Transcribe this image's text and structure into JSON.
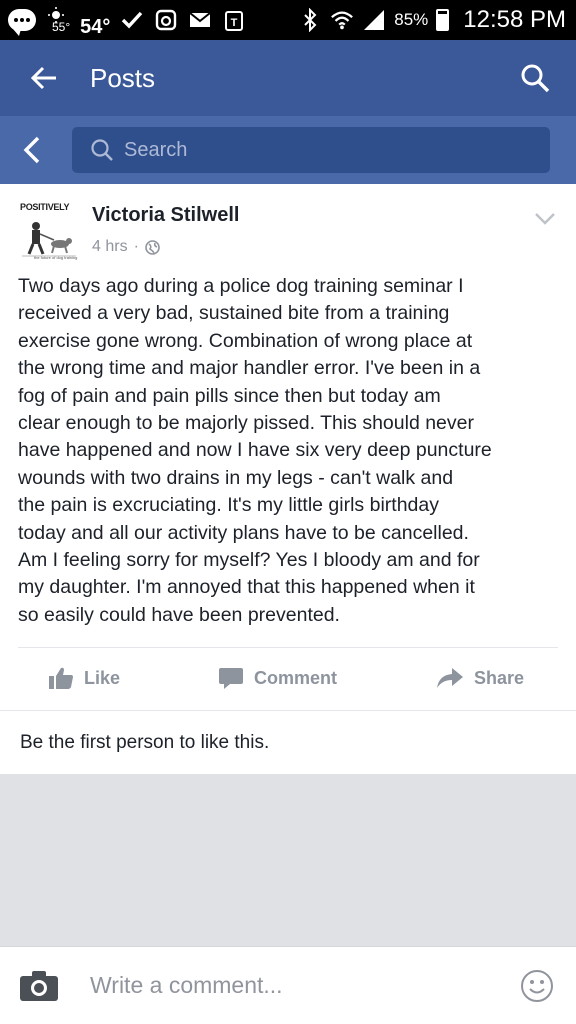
{
  "status_bar": {
    "weather_low": "55°",
    "temperature": "54°",
    "battery": "85%",
    "time": "12:58 PM"
  },
  "app_bar": {
    "title": "Posts"
  },
  "search": {
    "placeholder": "Search"
  },
  "post": {
    "page_avatar_text": "POSITIVELY",
    "page_avatar_tagline": "the future of dog training",
    "author": "Victoria Stilwell",
    "time": "4 hrs",
    "separator": "·",
    "lines": [
      "Two days ago during a police dog training seminar I",
      "received a very bad, sustained bite from a training",
      "exercise gone wrong. Combination of wrong place at",
      "the wrong time and major handler error. I've been in a",
      "fog of pain and pain pills since then but today am",
      "clear enough to be majorly pissed. This should never",
      "have happened and now I have six very deep puncture",
      "wounds with two drains in my legs - can't walk and",
      "the pain is excruciating. It's my little girls birthday",
      "today and all our activity plans have to be cancelled.",
      "Am I feeling sorry for myself? Yes I bloody am and for",
      "my daughter. I'm annoyed that this happened when it",
      "so easily could have been prevented."
    ],
    "actions": {
      "like": "Like",
      "comment": "Comment",
      "share": "Share"
    },
    "likes_text": "Be the first person to like this."
  },
  "composer": {
    "placeholder": "Write a comment..."
  },
  "colors": {
    "facebook_blue": "#3b5998",
    "search_bar": "#4a69a9",
    "text": "#1d2129",
    "muted": "#90949c"
  },
  "icons": [
    "chat-notification-icon",
    "weather-sun-icon",
    "check-icon",
    "instagram-icon",
    "mail-icon",
    "tmobile-icon",
    "bluetooth-icon",
    "wifi-icon",
    "signal-icon",
    "battery-icon",
    "back-arrow-icon",
    "search-icon",
    "chevron-left-icon",
    "globe-icon",
    "chevron-down-icon",
    "thumbs-up-icon",
    "comment-icon",
    "share-arrow-icon",
    "camera-icon",
    "emoji-icon"
  ]
}
